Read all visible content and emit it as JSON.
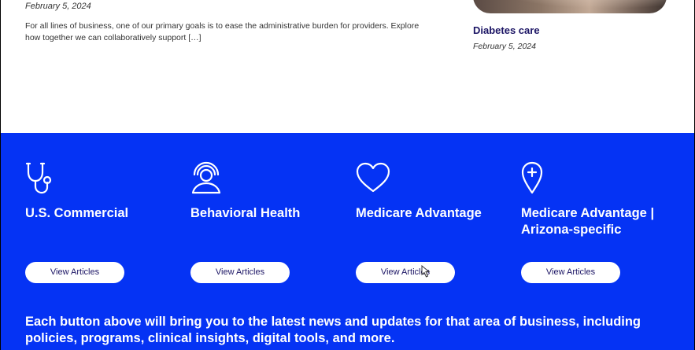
{
  "top": {
    "left_article": {
      "date": "February 5, 2024",
      "excerpt": "For all lines of business, one of our primary goals is to ease the administrative burden for providers. Explore how together we can collaboratively support […]"
    },
    "right_article": {
      "title": "Diabetes care",
      "date": "February 5, 2024"
    }
  },
  "business_areas": [
    {
      "icon": "stethoscope-icon",
      "title": "U.S. Commercial",
      "button": "View Articles"
    },
    {
      "icon": "person-wellbeing-icon",
      "title": "Behavioral Health",
      "button": "View Articles"
    },
    {
      "icon": "heart-icon",
      "title": "Medicare Advantage",
      "button": "View Articles"
    },
    {
      "icon": "location-pin-plus-icon",
      "title": "Medicare Advantage | Arizona-specific",
      "button": "View Articles"
    }
  ],
  "footer_text": "Each button above will bring you to the latest news and updates for that area of business, including policies, programs, clinical insights, digital tools, and more.",
  "colors": {
    "blue_band": "#0533f4",
    "title_navy": "#1b1464"
  }
}
